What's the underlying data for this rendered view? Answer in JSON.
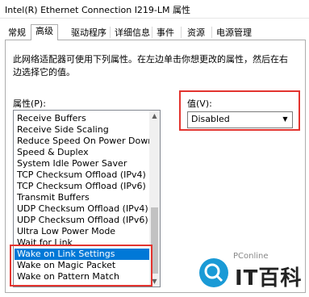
{
  "window": {
    "title": "Intel(R) Ethernet Connection I219-LM 属性"
  },
  "tabs": [
    {
      "label": "常规"
    },
    {
      "label": "高级"
    },
    {
      "label": "驱动程序"
    },
    {
      "label": "详细信息"
    },
    {
      "label": "事件"
    },
    {
      "label": "资源"
    },
    {
      "label": "电源管理"
    }
  ],
  "description": {
    "line1": "此网络适配器可使用下列属性。在左边单击你想更改的属性，然后在右",
    "line2": "边选择它的值。"
  },
  "properties": {
    "label": "属性(P):",
    "items": [
      "Receive Buffers",
      "Receive Side Scaling",
      "Reduce Speed On Power Down",
      "Speed & Duplex",
      "System Idle Power Saver",
      "TCP Checksum Offload (IPv4)",
      "TCP Checksum Offload (IPv6)",
      "Transmit Buffers",
      "UDP Checksum Offload (IPv4)",
      "UDP Checksum Offload (IPv6)",
      "Ultra Low Power Mode",
      "Wait for Link",
      "Wake on Link Settings",
      "Wake on Magic Packet",
      "Wake on Pattern Match"
    ],
    "selected": "Wake on Link Settings"
  },
  "value": {
    "label": "值(V):",
    "selected": "Disabled"
  },
  "watermark": {
    "brand": "PConline",
    "text": "IT百科"
  },
  "colors": {
    "highlight": "#0078d7",
    "annotation_red": "#e3342f"
  }
}
